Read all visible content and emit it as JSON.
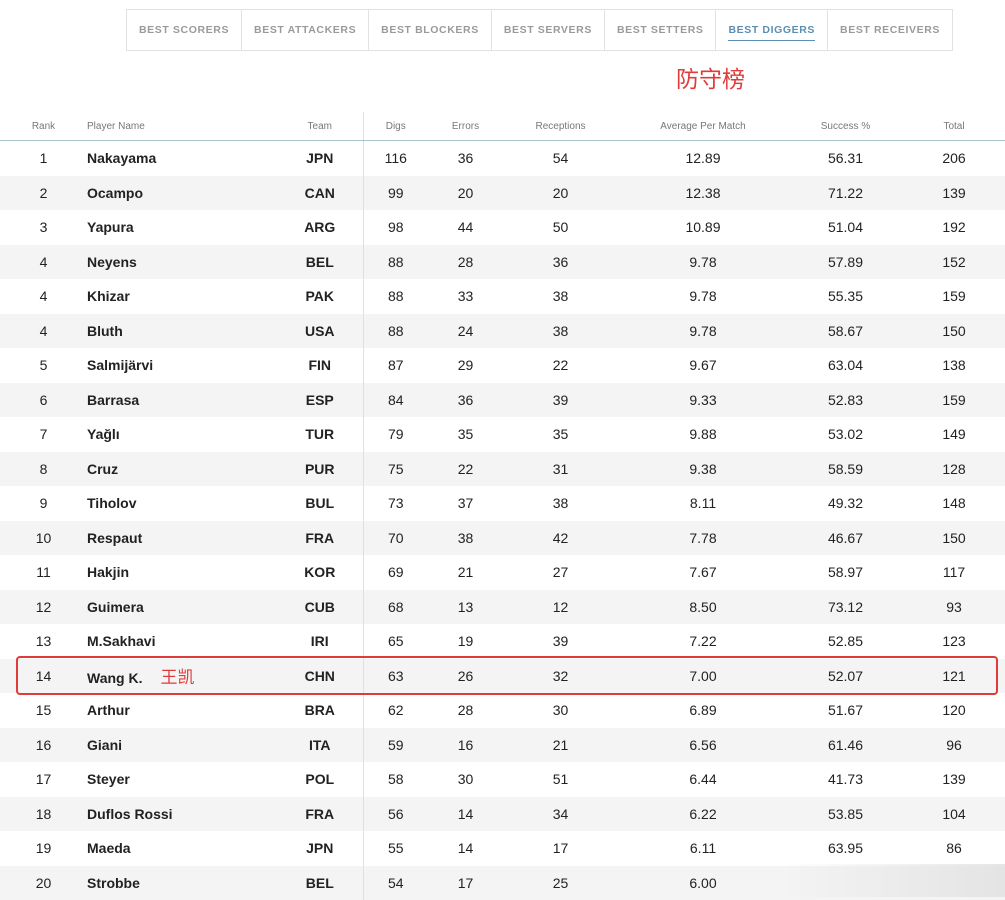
{
  "tabs": [
    {
      "label": "BEST SCORERS",
      "active": false
    },
    {
      "label": "BEST ATTACKERS",
      "active": false
    },
    {
      "label": "BEST BLOCKERS",
      "active": false
    },
    {
      "label": "BEST SERVERS",
      "active": false
    },
    {
      "label": "BEST SETTERS",
      "active": false
    },
    {
      "label": "BEST DIGGERS",
      "active": true
    },
    {
      "label": "BEST RECEIVERS",
      "active": false
    }
  ],
  "annotation": {
    "title": "防守榜",
    "color": "#e03b3b"
  },
  "table": {
    "headers": {
      "rank": "Rank",
      "player": "Player Name",
      "team": "Team",
      "digs": "Digs",
      "errors": "Errors",
      "receptions": "Receptions",
      "avg": "Average Per Match",
      "success": "Success %",
      "total": "Total"
    },
    "rows": [
      {
        "rank": "1",
        "player": "Nakayama",
        "cn": "",
        "team": "JPN",
        "digs": "116",
        "errors": "36",
        "receptions": "54",
        "avg": "12.89",
        "success": "56.31",
        "total": "206"
      },
      {
        "rank": "2",
        "player": "Ocampo",
        "cn": "",
        "team": "CAN",
        "digs": "99",
        "errors": "20",
        "receptions": "20",
        "avg": "12.38",
        "success": "71.22",
        "total": "139"
      },
      {
        "rank": "3",
        "player": "Yapura",
        "cn": "",
        "team": "ARG",
        "digs": "98",
        "errors": "44",
        "receptions": "50",
        "avg": "10.89",
        "success": "51.04",
        "total": "192"
      },
      {
        "rank": "4",
        "player": "Neyens",
        "cn": "",
        "team": "BEL",
        "digs": "88",
        "errors": "28",
        "receptions": "36",
        "avg": "9.78",
        "success": "57.89",
        "total": "152"
      },
      {
        "rank": "4",
        "player": "Khizar",
        "cn": "",
        "team": "PAK",
        "digs": "88",
        "errors": "33",
        "receptions": "38",
        "avg": "9.78",
        "success": "55.35",
        "total": "159"
      },
      {
        "rank": "4",
        "player": "Bluth",
        "cn": "",
        "team": "USA",
        "digs": "88",
        "errors": "24",
        "receptions": "38",
        "avg": "9.78",
        "success": "58.67",
        "total": "150"
      },
      {
        "rank": "5",
        "player": "Salmijärvi",
        "cn": "",
        "team": "FIN",
        "digs": "87",
        "errors": "29",
        "receptions": "22",
        "avg": "9.67",
        "success": "63.04",
        "total": "138"
      },
      {
        "rank": "6",
        "player": "Barrasa",
        "cn": "",
        "team": "ESP",
        "digs": "84",
        "errors": "36",
        "receptions": "39",
        "avg": "9.33",
        "success": "52.83",
        "total": "159"
      },
      {
        "rank": "7",
        "player": "Yağlı",
        "cn": "",
        "team": "TUR",
        "digs": "79",
        "errors": "35",
        "receptions": "35",
        "avg": "9.88",
        "success": "53.02",
        "total": "149"
      },
      {
        "rank": "8",
        "player": "Cruz",
        "cn": "",
        "team": "PUR",
        "digs": "75",
        "errors": "22",
        "receptions": "31",
        "avg": "9.38",
        "success": "58.59",
        "total": "128"
      },
      {
        "rank": "9",
        "player": "Tiholov",
        "cn": "",
        "team": "BUL",
        "digs": "73",
        "errors": "37",
        "receptions": "38",
        "avg": "8.11",
        "success": "49.32",
        "total": "148"
      },
      {
        "rank": "10",
        "player": "Respaut",
        "cn": "",
        "team": "FRA",
        "digs": "70",
        "errors": "38",
        "receptions": "42",
        "avg": "7.78",
        "success": "46.67",
        "total": "150"
      },
      {
        "rank": "11",
        "player": "Hakjin",
        "cn": "",
        "team": "KOR",
        "digs": "69",
        "errors": "21",
        "receptions": "27",
        "avg": "7.67",
        "success": "58.97",
        "total": "117"
      },
      {
        "rank": "12",
        "player": "Guimera",
        "cn": "",
        "team": "CUB",
        "digs": "68",
        "errors": "13",
        "receptions": "12",
        "avg": "8.50",
        "success": "73.12",
        "total": "93"
      },
      {
        "rank": "13",
        "player": "M.Sakhavi",
        "cn": "",
        "team": "IRI",
        "digs": "65",
        "errors": "19",
        "receptions": "39",
        "avg": "7.22",
        "success": "52.85",
        "total": "123"
      },
      {
        "rank": "14",
        "player": "Wang K.",
        "cn": "王凯",
        "team": "CHN",
        "digs": "63",
        "errors": "26",
        "receptions": "32",
        "avg": "7.00",
        "success": "52.07",
        "total": "121",
        "highlighted": true
      },
      {
        "rank": "15",
        "player": "Arthur",
        "cn": "",
        "team": "BRA",
        "digs": "62",
        "errors": "28",
        "receptions": "30",
        "avg": "6.89",
        "success": "51.67",
        "total": "120"
      },
      {
        "rank": "16",
        "player": "Giani",
        "cn": "",
        "team": "ITA",
        "digs": "59",
        "errors": "16",
        "receptions": "21",
        "avg": "6.56",
        "success": "61.46",
        "total": "96"
      },
      {
        "rank": "17",
        "player": "Steyer",
        "cn": "",
        "team": "POL",
        "digs": "58",
        "errors": "30",
        "receptions": "51",
        "avg": "6.44",
        "success": "41.73",
        "total": "139"
      },
      {
        "rank": "18",
        "player": "Duflos Rossi",
        "cn": "",
        "team": "FRA",
        "digs": "56",
        "errors": "14",
        "receptions": "34",
        "avg": "6.22",
        "success": "53.85",
        "total": "104"
      },
      {
        "rank": "19",
        "player": "Maeda",
        "cn": "",
        "team": "JPN",
        "digs": "55",
        "errors": "14",
        "receptions": "17",
        "avg": "6.11",
        "success": "63.95",
        "total": "86"
      },
      {
        "rank": "20",
        "player": "Strobbe",
        "cn": "",
        "team": "BEL",
        "digs": "54",
        "errors": "17",
        "receptions": "25",
        "avg": "6.00",
        "success": "",
        "total": ""
      }
    ]
  }
}
